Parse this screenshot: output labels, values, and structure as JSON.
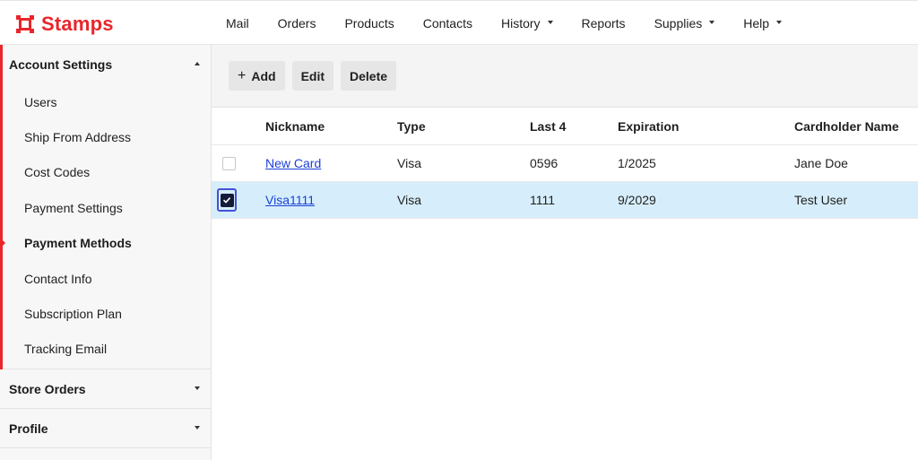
{
  "brand": {
    "name": "Stamps",
    "color": "#e8262c",
    "icon": "stamps-logo-icon"
  },
  "nav": [
    {
      "label": "Mail",
      "dropdown": false
    },
    {
      "label": "Orders",
      "dropdown": false
    },
    {
      "label": "Products",
      "dropdown": false
    },
    {
      "label": "Contacts",
      "dropdown": false
    },
    {
      "label": "History",
      "dropdown": true
    },
    {
      "label": "Reports",
      "dropdown": false
    },
    {
      "label": "Supplies",
      "dropdown": true
    },
    {
      "label": "Help",
      "dropdown": true
    }
  ],
  "sidebar": {
    "account_settings": {
      "label": "Account Settings",
      "expanded": true,
      "items": [
        {
          "label": "Users"
        },
        {
          "label": "Ship From Address"
        },
        {
          "label": "Cost Codes"
        },
        {
          "label": "Payment Settings"
        },
        {
          "label": "Payment Methods",
          "active": true
        },
        {
          "label": "Contact Info"
        },
        {
          "label": "Subscription Plan"
        },
        {
          "label": "Tracking Email"
        }
      ]
    },
    "store_orders": {
      "label": "Store Orders",
      "expanded": false
    },
    "profile": {
      "label": "Profile",
      "expanded": false
    }
  },
  "toolbar": {
    "add_label": "Add",
    "edit_label": "Edit",
    "delete_label": "Delete"
  },
  "table": {
    "columns": [
      "Nickname",
      "Type",
      "Last 4",
      "Expiration",
      "Cardholder Name"
    ],
    "rows": [
      {
        "nickname": "New Card",
        "type": "Visa",
        "last4": "0596",
        "expiration": "1/2025",
        "cardholder": "Jane Doe",
        "checked": false
      },
      {
        "nickname": "Visa1111",
        "type": "Visa",
        "last4": "1111",
        "expiration": "9/2029",
        "cardholder": "Test User",
        "checked": true
      }
    ]
  },
  "colors": {
    "accent": "#e8262c",
    "selected_row": "#d6eefb",
    "link": "#1a3fd6",
    "focus_ring": "#4650d8"
  }
}
